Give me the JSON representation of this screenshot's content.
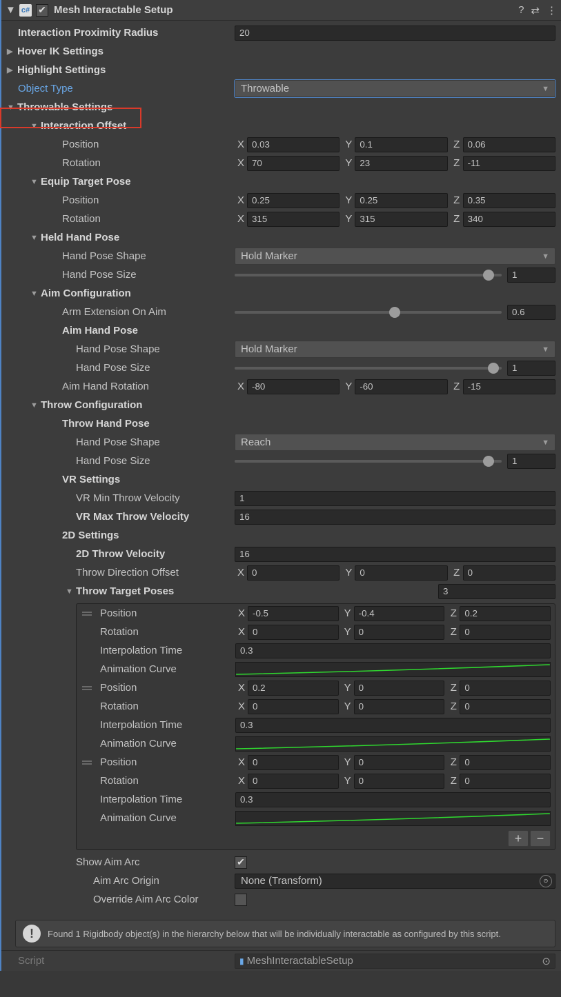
{
  "header": {
    "title": "Mesh Interactable Setup",
    "enabled": true
  },
  "props": {
    "interaction_proximity_radius": {
      "label": "Interaction Proximity Radius",
      "value": "20"
    },
    "hover_ik_settings": {
      "label": "Hover IK Settings"
    },
    "highlight_settings": {
      "label": "Highlight Settings"
    },
    "object_type": {
      "label": "Object Type",
      "value": "Throwable"
    },
    "throwable_settings": {
      "label": "Throwable Settings"
    },
    "interaction_offset": {
      "label": "Interaction Offset",
      "position": {
        "label": "Position",
        "x": "0.03",
        "y": "0.1",
        "z": "0.06"
      },
      "rotation": {
        "label": "Rotation",
        "x": "70",
        "y": "23",
        "z": "-11"
      }
    },
    "equip_target_pose": {
      "label": "Equip Target Pose",
      "position": {
        "label": "Position",
        "x": "0.25",
        "y": "0.25",
        "z": "0.35"
      },
      "rotation": {
        "label": "Rotation",
        "x": "315",
        "y": "315",
        "z": "340"
      }
    },
    "held_hand_pose": {
      "label": "Held Hand Pose",
      "shape": {
        "label": "Hand Pose Shape",
        "value": "Hold Marker"
      },
      "size": {
        "label": "Hand Pose Size",
        "value": "1",
        "pct": 95
      }
    },
    "aim_config": {
      "label": "Aim Configuration",
      "arm_ext": {
        "label": "Arm Extension On Aim",
        "value": "0.6",
        "pct": 60
      },
      "aim_hand_pose": {
        "label": "Aim Hand Pose",
        "shape": {
          "label": "Hand Pose Shape",
          "value": "Hold Marker"
        },
        "size": {
          "label": "Hand Pose Size",
          "value": "1",
          "pct": 97
        }
      },
      "aim_hand_rot": {
        "label": "Aim Hand Rotation",
        "x": "-80",
        "y": "-60",
        "z": "-15"
      }
    },
    "throw_config": {
      "label": "Throw Configuration",
      "throw_hand_pose": {
        "label": "Throw Hand Pose",
        "shape": {
          "label": "Hand Pose Shape",
          "value": "Reach"
        },
        "size": {
          "label": "Hand Pose Size",
          "value": "1",
          "pct": 95
        }
      },
      "vr": {
        "label": "VR Settings",
        "min": {
          "label": "VR Min Throw Velocity",
          "value": "1"
        },
        "max": {
          "label": "VR Max Throw Velocity",
          "value": "16"
        }
      },
      "d2": {
        "label": "2D Settings",
        "vel": {
          "label": "2D Throw Velocity",
          "value": "16"
        },
        "dir_off": {
          "label": "Throw Direction Offset",
          "x": "0",
          "y": "0",
          "z": "0"
        },
        "target_poses": {
          "label": "Throw Target Poses",
          "count": "3",
          "items": [
            {
              "pos": {
                "x": "-0.5",
                "y": "-0.4",
                "z": "0.2"
              },
              "rot": {
                "x": "0",
                "y": "0",
                "z": "0"
              },
              "interp": "0.3"
            },
            {
              "pos": {
                "x": "0.2",
                "y": "0",
                "z": "0"
              },
              "rot": {
                "x": "0",
                "y": "0",
                "z": "0"
              },
              "interp": "0.3"
            },
            {
              "pos": {
                "x": "0",
                "y": "0",
                "z": "0"
              },
              "rot": {
                "x": "0",
                "y": "0",
                "z": "0"
              },
              "interp": "0.3"
            }
          ],
          "field_labels": {
            "pos": "Position",
            "rot": "Rotation",
            "interp": "Interpolation Time",
            "curve": "Animation Curve"
          }
        },
        "show_aim_arc": {
          "label": "Show Aim Arc",
          "checked": true
        },
        "aim_arc_origin": {
          "label": "Aim Arc Origin",
          "value": "None (Transform)"
        },
        "override_aim_arc_color": {
          "label": "Override Aim Arc Color",
          "checked": false
        }
      }
    }
  },
  "info": "Found 1 Rigidbody object(s) in the hierarchy below that will be individually interactable as configured by this script.",
  "footer": {
    "label": "Script",
    "value": "MeshInteractableSetup"
  },
  "axis": {
    "x": "X",
    "y": "Y",
    "z": "Z"
  }
}
